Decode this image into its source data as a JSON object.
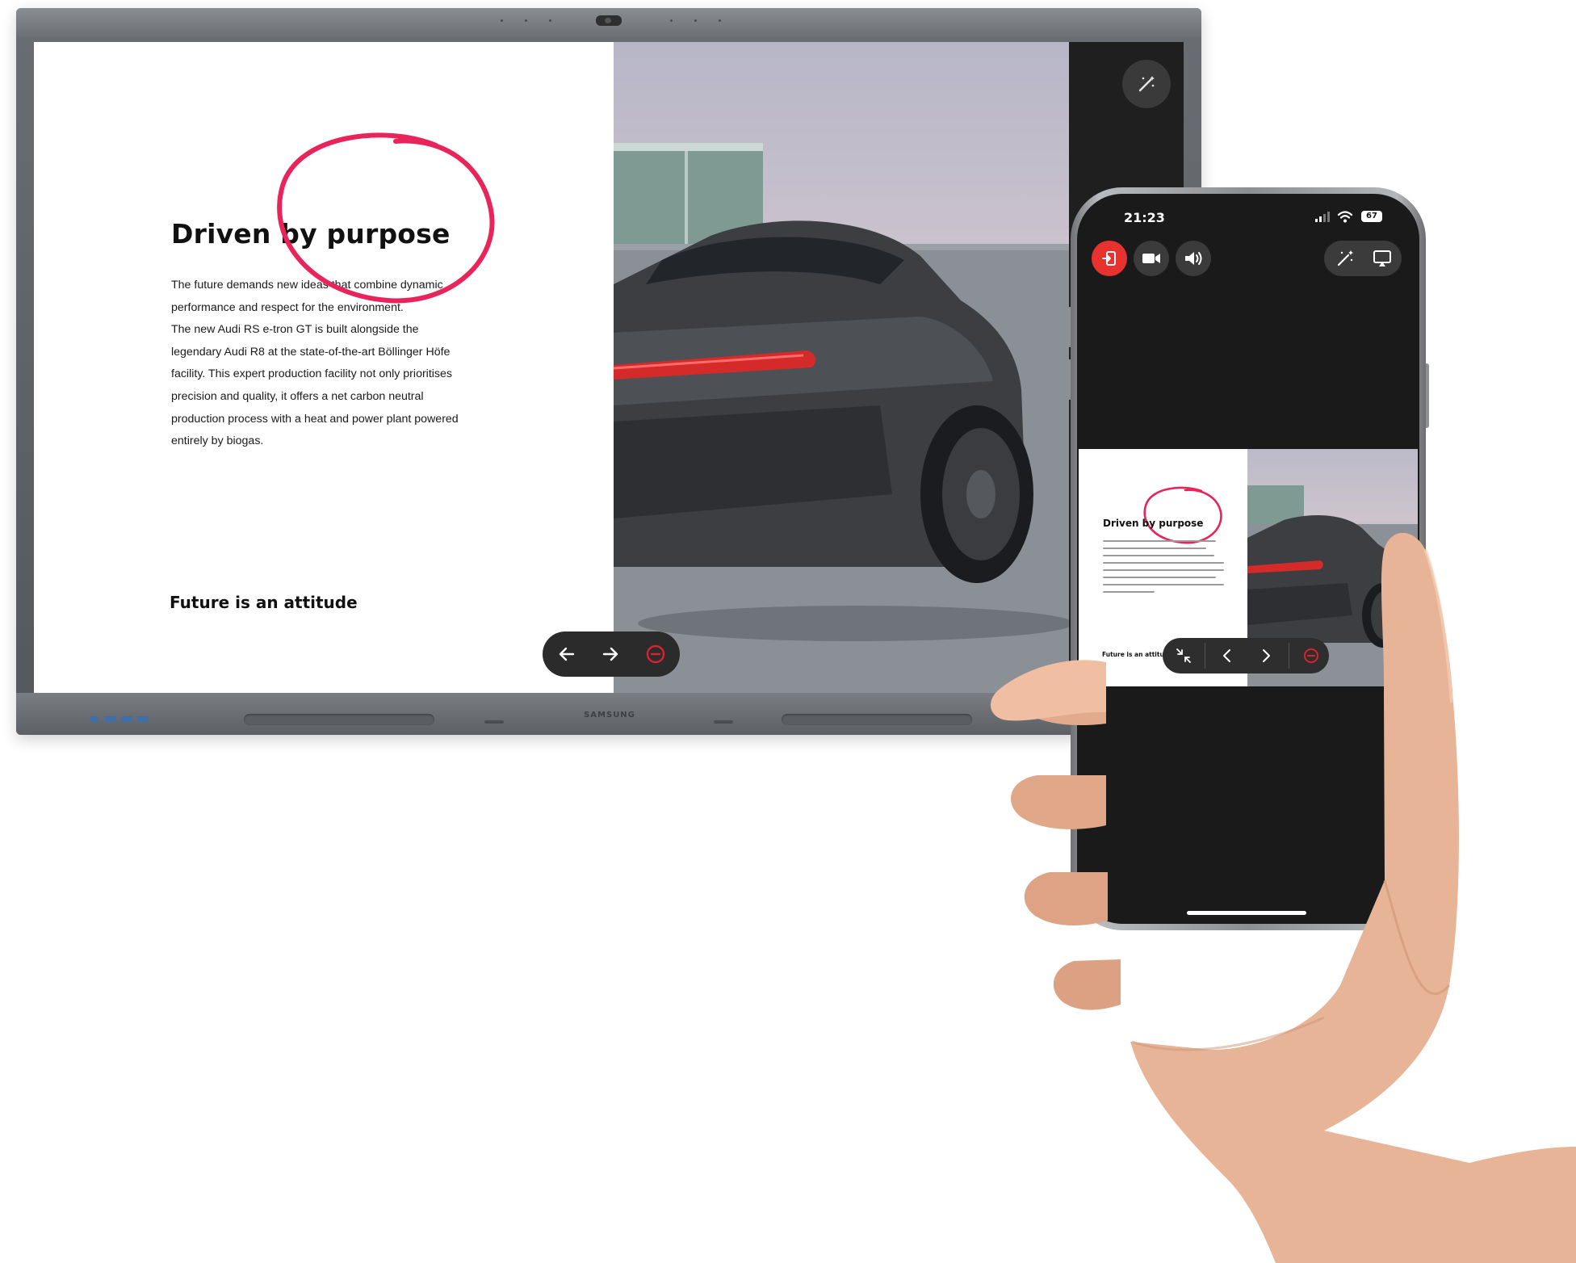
{
  "display": {
    "brand": "SAMSUNG",
    "slide": {
      "title": "Driven by purpose",
      "body_lines": [
        "The future demands new ideas that combine dynamic",
        "performance and respect for the environment.",
        "The new Audi RS e-tron GT is built alongside the",
        "legendary Audi R8 at the state-of-the-art Böllinger Höfe",
        "facility. This expert production facility not only prioritises",
        "precision and quality, it offers a net carbon neutral",
        "production process with a heat and power plant powered",
        "entirely by biogas."
      ],
      "subtitle": "Future is an attitude"
    },
    "annotation_color": "#e8245a",
    "stop_color": "#d9232e",
    "icons": [
      "arrow-left-icon",
      "arrow-right-icon",
      "stop-icon",
      "magic-wand-icon"
    ]
  },
  "phone": {
    "status": {
      "time": "21:23",
      "battery": "67"
    },
    "toolbar_icons": [
      "exit-share-icon",
      "camera-icon",
      "speaker-icon",
      "magic-wand-icon",
      "cast-screen-icon"
    ],
    "exit_button_color": "#e8322f",
    "mini_slide": {
      "title": "Driven by purpose",
      "subtitle": "Future is an attitude"
    },
    "mini_nav_icons": [
      "collapse-icon",
      "chevron-left-icon",
      "chevron-right-icon",
      "stop-icon"
    ]
  }
}
